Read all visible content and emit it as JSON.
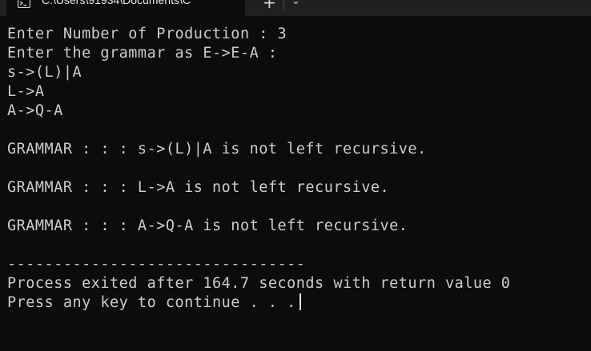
{
  "tab": {
    "title": "C:\\Users\\91934\\Documents\\C",
    "icon": "terminal-icon",
    "close_glyph": "✕",
    "new_tab_glyph": "+",
    "dropdown_glyph": "⌄"
  },
  "console": {
    "lines": [
      "Enter Number of Production : 3",
      "Enter the grammar as E->E-A :",
      "s->(L)|A",
      "L->A",
      "A->Q-A",
      "",
      "GRAMMAR : : : s->(L)|A is not left recursive.",
      "",
      "GRAMMAR : : : L->A is not left recursive.",
      "",
      "GRAMMAR : : : A->Q-A is not left recursive.",
      "",
      "--------------------------------",
      "Process exited after 164.7 seconds with return value 0",
      "Press any key to continue . . ."
    ]
  },
  "colors": {
    "background": "#0c0c0c",
    "foreground": "#cccccc",
    "tabbar": "#202020"
  }
}
